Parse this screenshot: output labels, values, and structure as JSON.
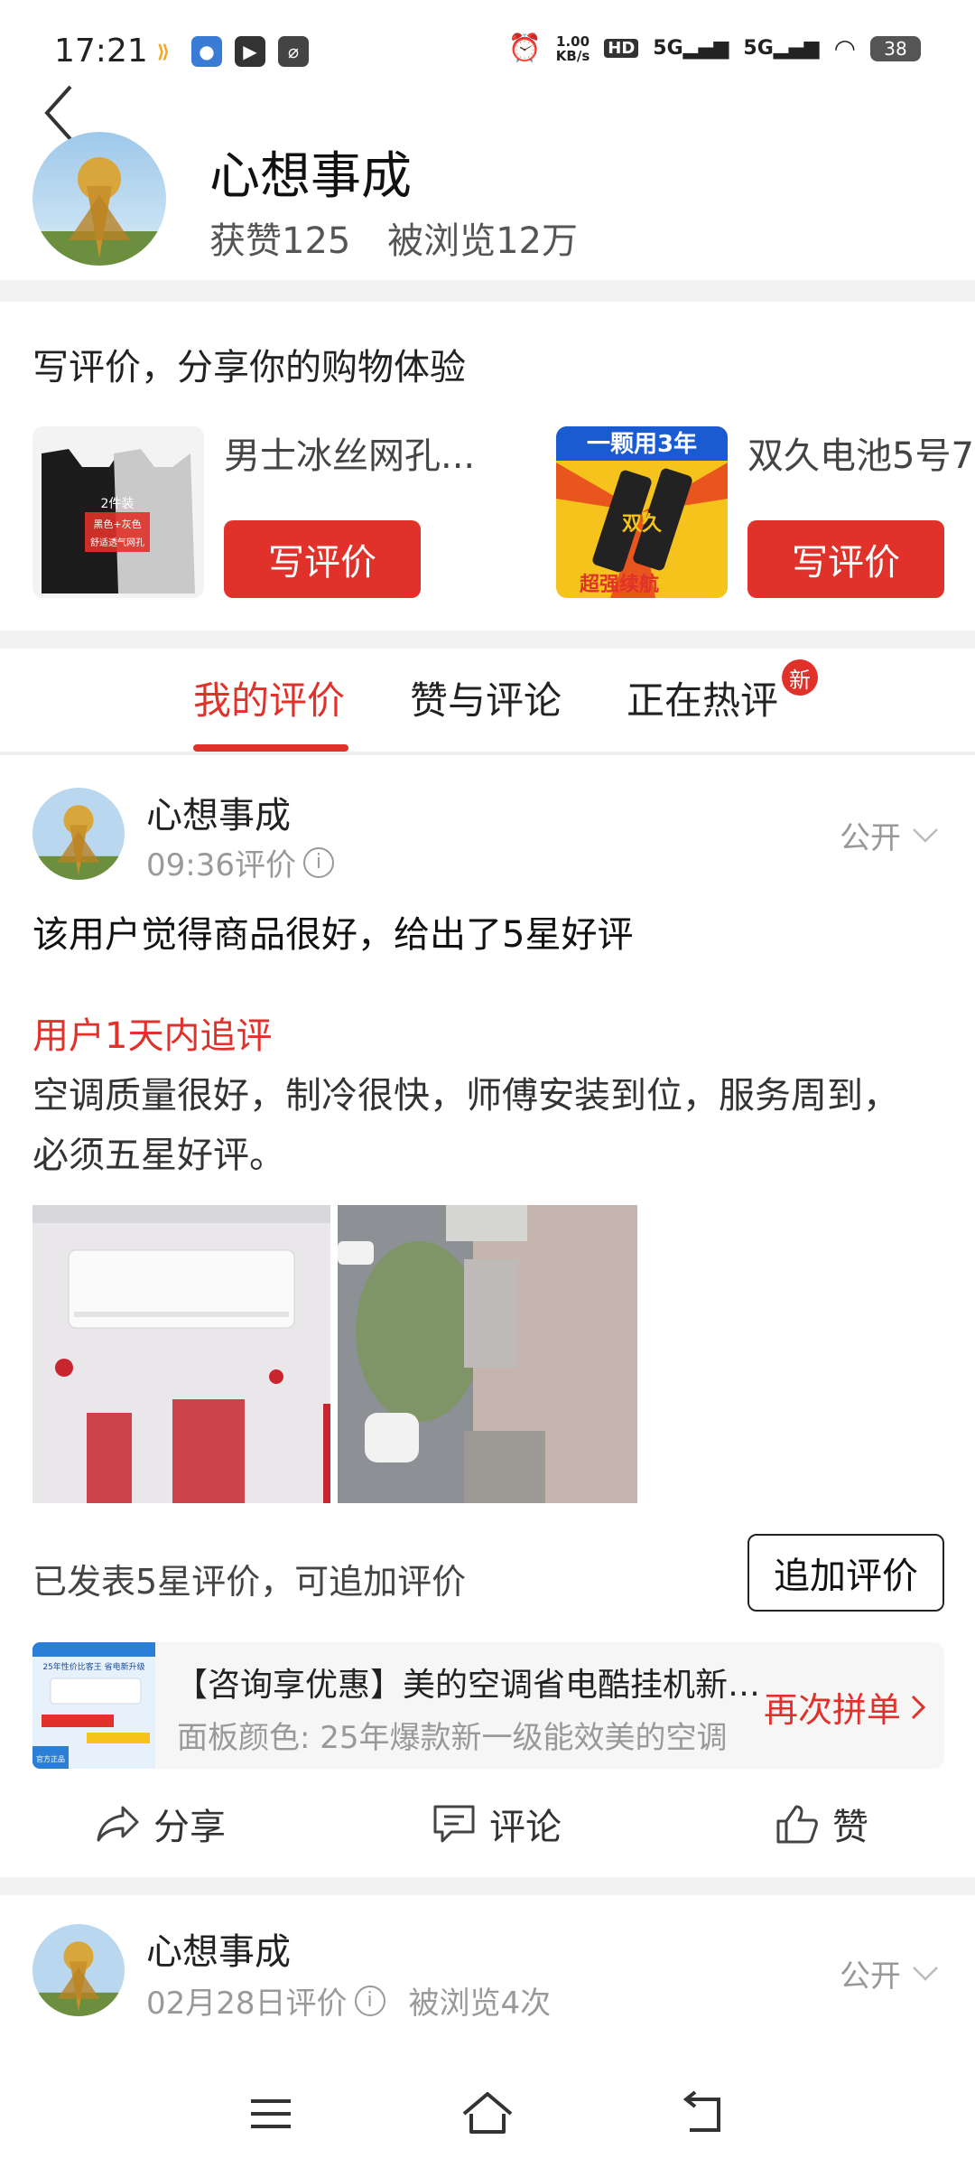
{
  "status_bar": {
    "time": "17:21",
    "speed_top": "1.00",
    "speed_bottom": "KB/s",
    "hd": "HD",
    "net1": "5G",
    "net2": "5G",
    "battery": "38"
  },
  "profile": {
    "name": "心想事成",
    "likes": "获赞125",
    "views": "被浏览12万"
  },
  "write_review": {
    "title": "写评价，分享你的购物体验",
    "products": [
      {
        "name": "男士冰丝网孔...",
        "button": "写评价",
        "img_text_1": "2件装",
        "img_text_2": "黑色+灰色",
        "img_text_3": "舒适透气网孔"
      },
      {
        "name": "双久电池5号7",
        "button": "写评价",
        "img_text_1": "一颗用3年",
        "img_text_2": "超强续航",
        "img_text_3": "双久"
      }
    ]
  },
  "tabs": {
    "items": [
      "我的评价",
      "赞与评论",
      "正在热评"
    ],
    "badge": "新"
  },
  "review1": {
    "user": "心想事成",
    "time": "09:36评价",
    "visibility": "公开",
    "summary": "该用户觉得商品很好，给出了5星好评",
    "follow_up_title": "用户1天内追评",
    "follow_up_text": "空调质量很好，制冷很快，师傅安装到位，服务周到，必须五星好评。",
    "posted_note": "已发表5星评价，可追加评价",
    "add_button": "追加评价",
    "order": {
      "title": "【咨询享优惠】美的空调省电酷挂机新一级能效",
      "spec": "面板颜色: 25年爆款新一级能效美的空调",
      "rebuy": "再次拼单",
      "img_text_1": "25年性价比客王 省电新升级",
      "img_text_2": "官方正品"
    },
    "actions": {
      "share": "分享",
      "comment": "评论",
      "like": "赞"
    }
  },
  "review2": {
    "user": "心想事成",
    "time": "02月28日评价",
    "views": "被浏览4次",
    "visibility": "公开"
  },
  "colors": {
    "accent": "#e0312a",
    "divider": "#f2f2f2"
  }
}
